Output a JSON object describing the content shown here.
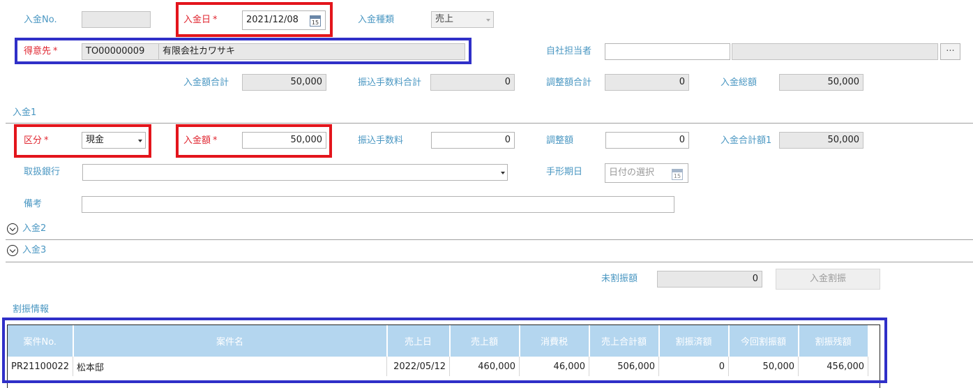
{
  "header": {
    "no_label": "入金No.",
    "no_value": "",
    "date_label": "入金日",
    "date_value": "2021/12/08",
    "type_label": "入金種類",
    "type_value": "売上",
    "customer_label": "得意先",
    "customer_code": "TO00000009",
    "customer_name": "有限会社カワサキ",
    "staff_label": "自社担当者",
    "staff_code": "",
    "staff_name": "",
    "staff_button": "···",
    "required_mark": "*"
  },
  "totals": {
    "amount_label": "入金額合計",
    "amount_value": "50,000",
    "fee_label": "振込手数料合計",
    "fee_value": "0",
    "adjust_label": "調整額合計",
    "adjust_value": "0",
    "grand_label": "入金総額",
    "grand_value": "50,000"
  },
  "payment1": {
    "section": "入金1",
    "kind_label": "区分",
    "kind_value": "現金",
    "amount_label": "入金額",
    "amount_value": "50,000",
    "fee_label": "振込手数料",
    "fee_value": "0",
    "adjust_label": "調整額",
    "adjust_value": "0",
    "subtotal_label": "入金合計額1",
    "subtotal_value": "50,000",
    "bank_label": "取扱銀行",
    "bank_value": "",
    "bill_label": "手形期日",
    "bill_placeholder": "日付の選択",
    "note_label": "備考",
    "note_value": ""
  },
  "payment2": {
    "section": "入金2"
  },
  "payment3": {
    "section": "入金3"
  },
  "allocation": {
    "unallocated_label": "未割振額",
    "unallocated_value": "0",
    "button": "入金割振",
    "section": "割振情報"
  },
  "calendar_day": "15",
  "table": {
    "columns": [
      "案件No.",
      "案件名",
      "売上日",
      "売上額",
      "消費税",
      "売上合計額",
      "割振済額",
      "今回割振額",
      "割振残額"
    ],
    "rows": [
      [
        "PR21100022",
        "松本邸",
        "2022/05/12",
        "460,000",
        "46,000",
        "506,000",
        "0",
        "50,000",
        "456,000"
      ]
    ]
  },
  "colors": {
    "label": "#4a97c2",
    "required": "#e0252f",
    "header_bg": "#b4d6ef",
    "readonly_bg": "#e8e8e8",
    "highlight_red": "#e3151c",
    "highlight_blue": "#3030c8"
  }
}
